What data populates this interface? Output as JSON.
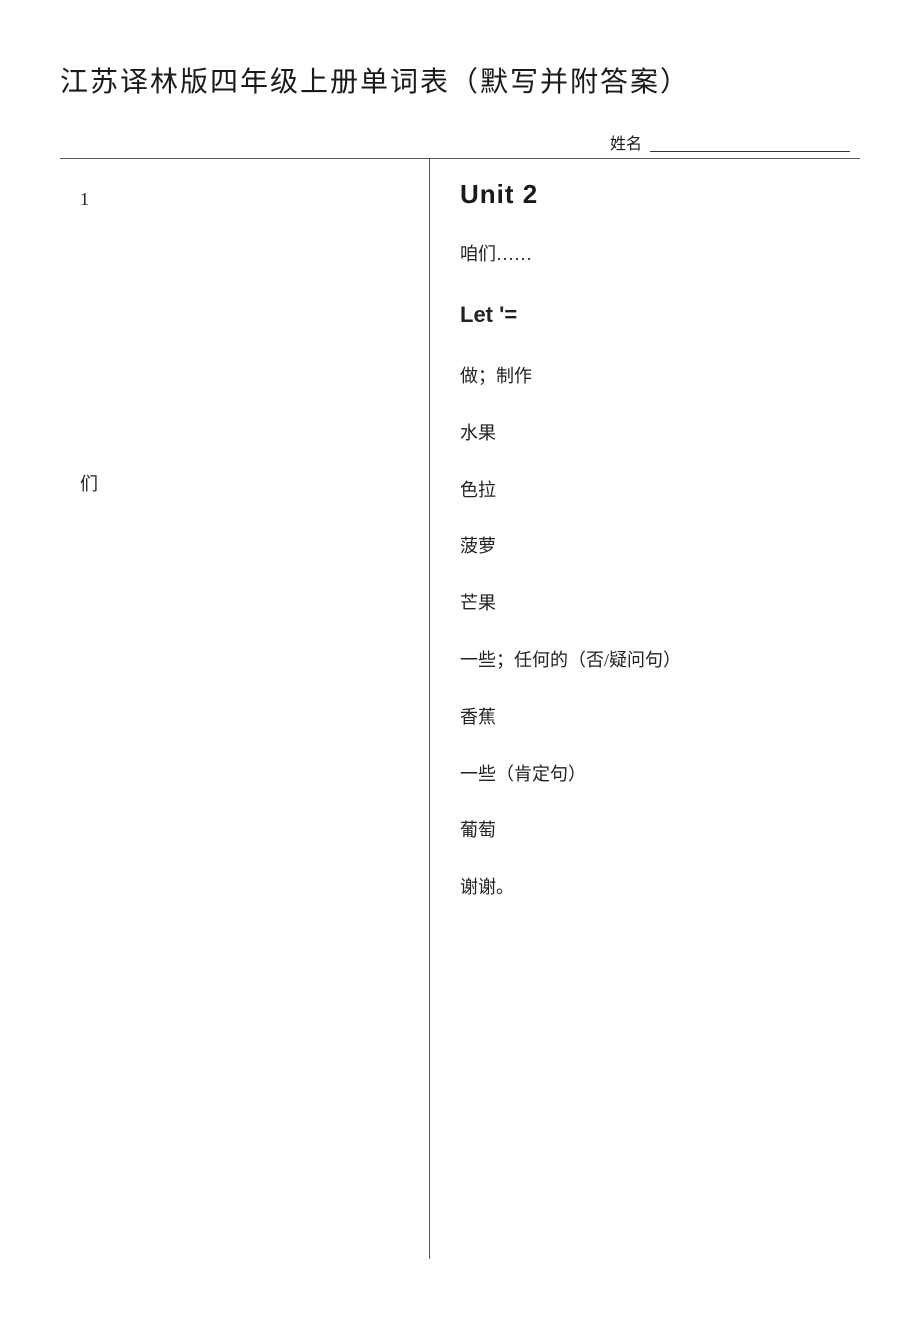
{
  "page": {
    "title": "江苏译林版四年级上册单词表（默写并附答案）",
    "name_label": "姓名",
    "name_line_placeholder": ""
  },
  "left_column": {
    "items": [
      {
        "id": "left-1",
        "text": "1"
      },
      {
        "id": "left-2",
        "text": "们"
      }
    ]
  },
  "right_column": {
    "unit_title": "Unit 2",
    "words": [
      {
        "id": "w1",
        "text": "咱们……",
        "bold": false
      },
      {
        "id": "w2",
        "text": "Let '=",
        "bold": true
      },
      {
        "id": "w3",
        "text": "做；制作",
        "bold": false
      },
      {
        "id": "w4",
        "text": "水果",
        "bold": false
      },
      {
        "id": "w5",
        "text": "色拉",
        "bold": false
      },
      {
        "id": "w6",
        "text": "菠萝",
        "bold": false
      },
      {
        "id": "w7",
        "text": "芒果",
        "bold": false
      },
      {
        "id": "w8",
        "text": "一些；任何的（否/疑问句）",
        "bold": false
      },
      {
        "id": "w9",
        "text": "香蕉",
        "bold": false
      },
      {
        "id": "w10",
        "text": "一些（肯定句）",
        "bold": false
      },
      {
        "id": "w11",
        "text": "葡萄",
        "bold": false
      },
      {
        "id": "w12",
        "text": "谢谢。",
        "bold": false
      }
    ]
  }
}
